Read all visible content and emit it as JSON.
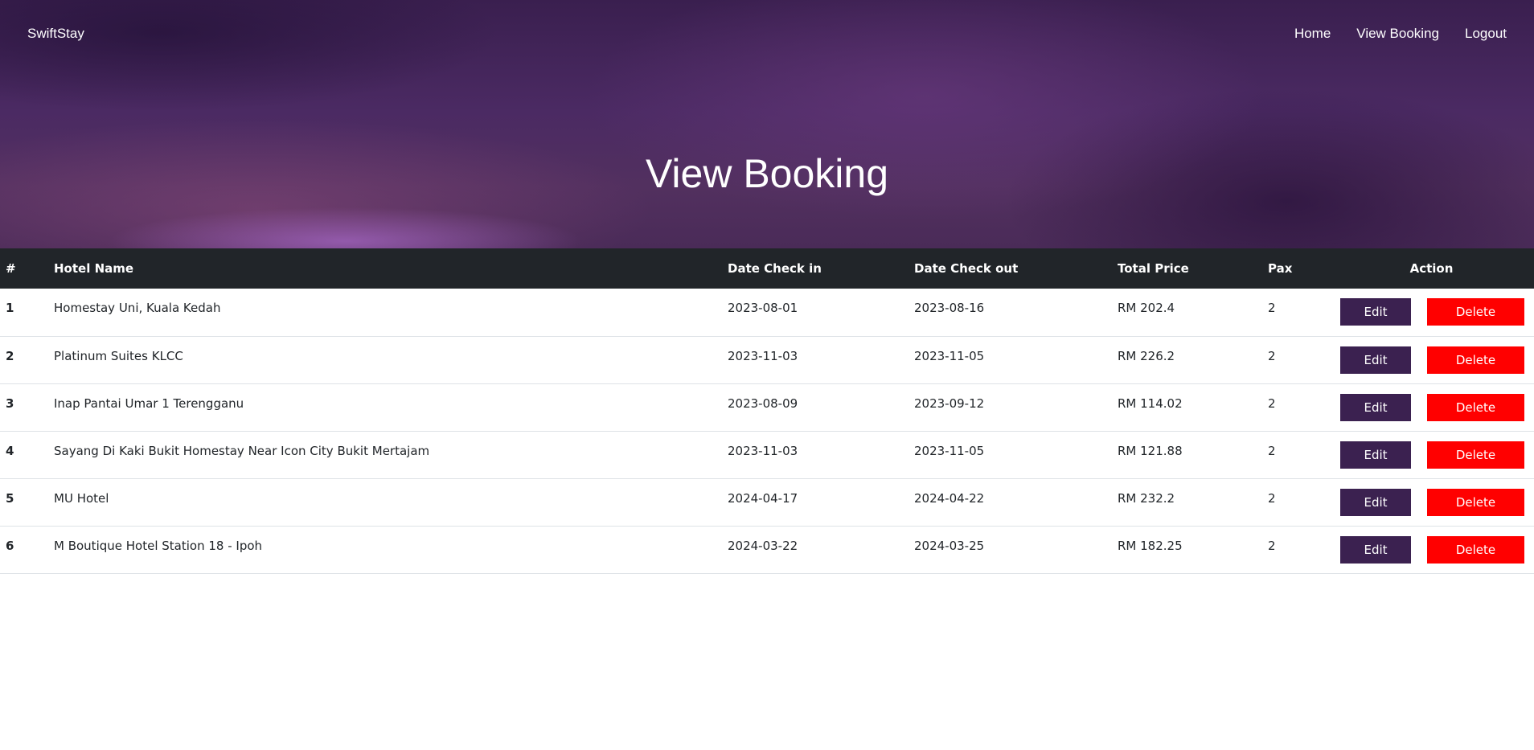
{
  "nav": {
    "brand": "SwiftStay",
    "links": [
      "Home",
      "View Booking",
      "Logout"
    ]
  },
  "hero": {
    "title": "View Booking"
  },
  "table": {
    "headers": [
      "#",
      "Hotel Name",
      "Date Check in",
      "Date Check out",
      "Total Price",
      "Pax",
      "Action"
    ],
    "edit_label": "Edit",
    "delete_label": "Delete",
    "rows": [
      {
        "num": "1",
        "hotel": "Homestay Uni, Kuala Kedah",
        "check_in": "2023-08-01",
        "check_out": "2023-08-16",
        "price": "RM 202.4",
        "pax": "2"
      },
      {
        "num": "2",
        "hotel": "Platinum Suites KLCC",
        "check_in": "2023-11-03",
        "check_out": "2023-11-05",
        "price": "RM 226.2",
        "pax": "2"
      },
      {
        "num": "3",
        "hotel": "Inap Pantai Umar 1 Terengganu",
        "check_in": "2023-08-09",
        "check_out": "2023-09-12",
        "price": "RM 114.02",
        "pax": "2"
      },
      {
        "num": "4",
        "hotel": "Sayang Di Kaki Bukit Homestay Near Icon City Bukit Mertajam",
        "check_in": "2023-11-03",
        "check_out": "2023-11-05",
        "price": "RM 121.88",
        "pax": "2"
      },
      {
        "num": "5",
        "hotel": "MU Hotel",
        "check_in": "2024-04-17",
        "check_out": "2024-04-22",
        "price": "RM 232.2",
        "pax": "2"
      },
      {
        "num": "6",
        "hotel": "M Boutique Hotel Station 18 - Ipoh",
        "check_in": "2024-03-22",
        "check_out": "2024-03-25",
        "price": "RM 182.25",
        "pax": "2"
      }
    ]
  },
  "colors": {
    "header_bg": "#212529",
    "edit_button": "#3b2150",
    "delete_button": "#ff0000"
  }
}
